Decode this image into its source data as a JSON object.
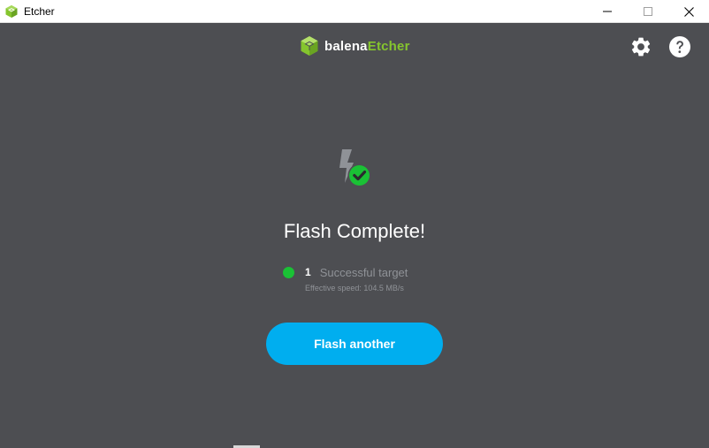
{
  "window": {
    "title": "Etcher",
    "icon": "etcher-cube-icon",
    "controls": [
      "minimize-icon",
      "maximize-icon",
      "close-icon"
    ]
  },
  "brand": {
    "part1": "balena",
    "part2": "Etcher",
    "accent": "#85c52e"
  },
  "header": {
    "settings_icon": "gear-icon",
    "help_icon": "question-circle-icon"
  },
  "main": {
    "status_icon": "flash-complete-check-icon",
    "headline": "Flash Complete!",
    "result": {
      "count": "1",
      "label": "Successful target",
      "status_color": "#1ac135"
    },
    "speed": "Effective speed: 104.5 MB/s",
    "button_label": "Flash another",
    "button_color": "#00aeef"
  },
  "colors": {
    "background": "#4d4e52",
    "text_muted": "#8f9297"
  }
}
